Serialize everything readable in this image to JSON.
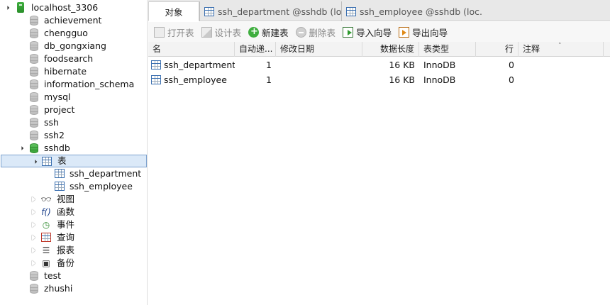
{
  "tree": {
    "connection": "localhost_3306",
    "databases": [
      "achievement",
      "chengguo",
      "db_gongxiang",
      "foodsearch",
      "hibernate",
      "information_schema",
      "mysql",
      "project",
      "ssh",
      "ssh2"
    ],
    "open_database": "sshdb",
    "tables_node": "表",
    "tables": [
      "ssh_department",
      "ssh_employee"
    ],
    "other_nodes": [
      "视图",
      "函数",
      "事件",
      "查询",
      "报表",
      "备份"
    ],
    "trailing_databases": [
      "test",
      "zhushi"
    ]
  },
  "tabs": [
    {
      "label": "对象"
    },
    {
      "label": "ssh_department @sshdb (lo..."
    },
    {
      "label": "ssh_employee @sshdb (loc..."
    }
  ],
  "toolbar": {
    "open": "打开表",
    "design": "设计表",
    "new": "新建表",
    "delete": "删除表",
    "import": "导入向导",
    "export": "导出向导"
  },
  "grid": {
    "columns": [
      "名",
      "自动递...",
      "修改日期",
      "数据长度",
      "表类型",
      "行",
      "注释"
    ],
    "rows": [
      {
        "name": "ssh_department",
        "auto_inc": "1",
        "modified": "",
        "data_length": "16 KB",
        "engine": "InnoDB",
        "rows": "0",
        "comment": ""
      },
      {
        "name": "ssh_employee",
        "auto_inc": "1",
        "modified": "",
        "data_length": "16 KB",
        "engine": "InnoDB",
        "rows": "0",
        "comment": ""
      }
    ]
  },
  "colors": {
    "selected_bg": "#dbe9f8",
    "selected_border": "#7da2ce",
    "active_db": "#3aa43a",
    "tabbar_bg": "#e8e8e8"
  }
}
